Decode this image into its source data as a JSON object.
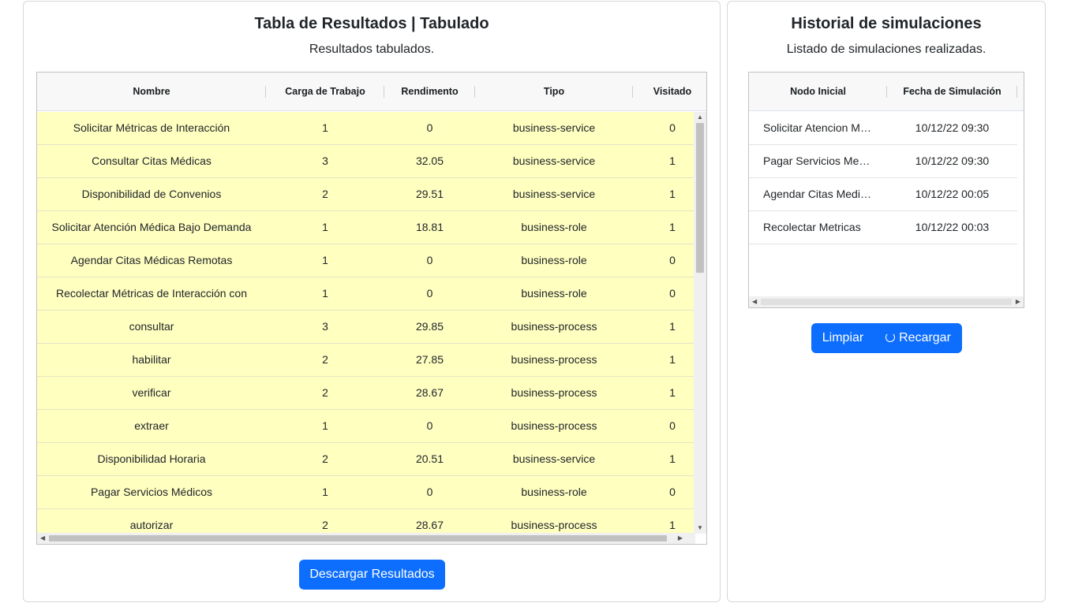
{
  "results_panel": {
    "title": "Tabla de Resultados | Tabulado",
    "subtitle": "Resultados tabulados.",
    "columns": [
      "Nombre",
      "Carga de Trabajo",
      "Rendimento",
      "Tipo",
      "Visitado"
    ],
    "rows": [
      [
        "Solicitar Métricas de Interacción",
        "1",
        "0",
        "business-service",
        "0"
      ],
      [
        "Consultar Citas Médicas",
        "3",
        "32.05",
        "business-service",
        "1"
      ],
      [
        "Disponibilidad de Convenios",
        "2",
        "29.51",
        "business-service",
        "1"
      ],
      [
        "Solicitar Atención Médica Bajo Demanda",
        "1",
        "18.81",
        "business-role",
        "1"
      ],
      [
        "Agendar Citas Médicas Remotas",
        "1",
        "0",
        "business-role",
        "0"
      ],
      [
        "Recolectar Métricas de Interacción con",
        "1",
        "0",
        "business-role",
        "0"
      ],
      [
        "consultar",
        "3",
        "29.85",
        "business-process",
        "1"
      ],
      [
        "habilitar",
        "2",
        "27.85",
        "business-process",
        "1"
      ],
      [
        "verificar",
        "2",
        "28.67",
        "business-process",
        "1"
      ],
      [
        "extraer",
        "1",
        "0",
        "business-process",
        "0"
      ],
      [
        "Disponibilidad Horaria",
        "2",
        "20.51",
        "business-service",
        "1"
      ],
      [
        "Pagar Servicios Médicos",
        "1",
        "0",
        "business-role",
        "0"
      ],
      [
        "autorizar",
        "2",
        "28.67",
        "business-process",
        "1"
      ]
    ],
    "download_button": "Descargar Resultados",
    "row_highlight_color": "#ffffc0",
    "accent_color": "#0d6efd"
  },
  "history_panel": {
    "title": "Historial de simulaciones",
    "subtitle": "Listado de simulaciones realizadas.",
    "columns": [
      "Nodo Inicial",
      "Fecha de Simulación"
    ],
    "rows": [
      [
        "Solicitar Atencion Medica",
        "10/12/22 09:30"
      ],
      [
        "Pagar Servicios Medicos",
        "10/12/22 09:30"
      ],
      [
        "Agendar Citas Medicas",
        "10/12/22 00:05"
      ],
      [
        "Recolectar Metricas",
        "10/12/22 00:03"
      ]
    ],
    "clear_button": "Limpiar",
    "reload_button": "Recargar",
    "reload_icon": "reload-icon"
  }
}
